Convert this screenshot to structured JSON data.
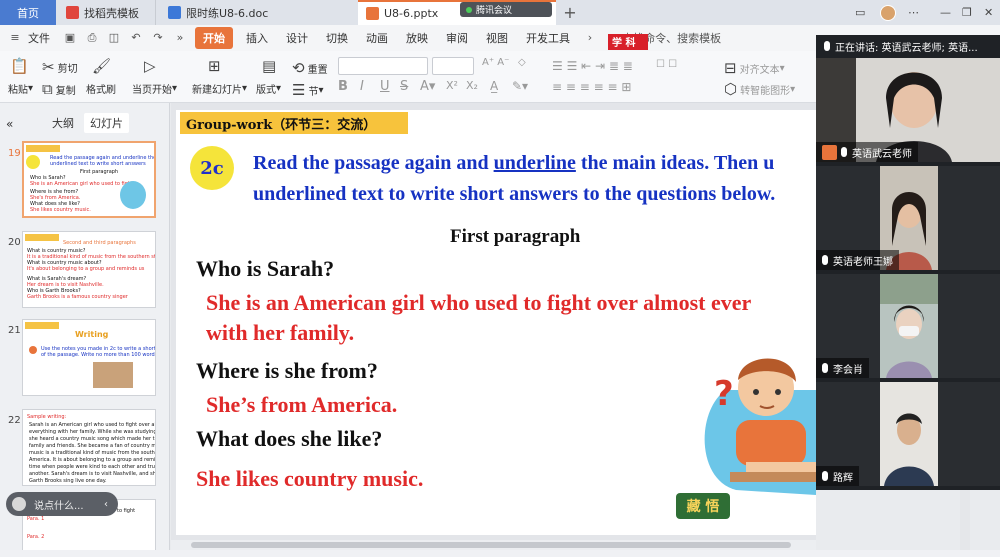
{
  "tabs": {
    "home": "首页",
    "tab1": "找稻壳模板",
    "tab2": "限时练U8-6.doc",
    "tab3": "U8-6.pptx",
    "meeting_badge": "腾讯会议"
  },
  "menu": {
    "file": "文件",
    "items": [
      "开始",
      "插入",
      "设计",
      "切换",
      "动画",
      "放映",
      "审阅",
      "视图",
      "开发工具"
    ],
    "search_placeholder": "查找命令、搜索模板"
  },
  "ribbon": {
    "paste": "粘贴",
    "cut": "剪切",
    "copy": "复制",
    "format_painter": "格式刷",
    "from_current": "当页开始",
    "new_slide": "新建幻灯片",
    "layout": "版式",
    "section": "节",
    "reset": "重置",
    "align_text": "对齐文本",
    "convert_smartart": "转智能图形"
  },
  "left_panel": {
    "tab_outline": "大纲",
    "tab_slides": "幻灯片",
    "slide_numbers": [
      "19",
      "20",
      "21",
      "22"
    ],
    "chat_placeholder": "说点什么..."
  },
  "slide": {
    "heading": "Group-work（环节三：交流）",
    "badge": "2c",
    "instruction_line1_a": "Read the passage again and ",
    "instruction_line1_u": "underline",
    "instruction_line1_b": " the main ideas. Then u",
    "instruction_line2": "underlined text to write short answers to the questions below.",
    "subtitle": "First paragraph",
    "q1": "Who is Sarah?",
    "a1_line1": "She is an American girl who used to fight over almost ever",
    "a1_line2": "with her family.",
    "q2": "Where is she from?",
    "a2": "She’s from America.",
    "q3": "What does she like?",
    "a3": "She likes country music.",
    "tag": "学 科",
    "logo": "藏 悟"
  },
  "meeting": {
    "speaking": "正在讲话: 英语武云老师; 英语...",
    "participants": [
      "英语武云老师",
      "英语老师王娜",
      "李会肖",
      "路辉"
    ]
  }
}
